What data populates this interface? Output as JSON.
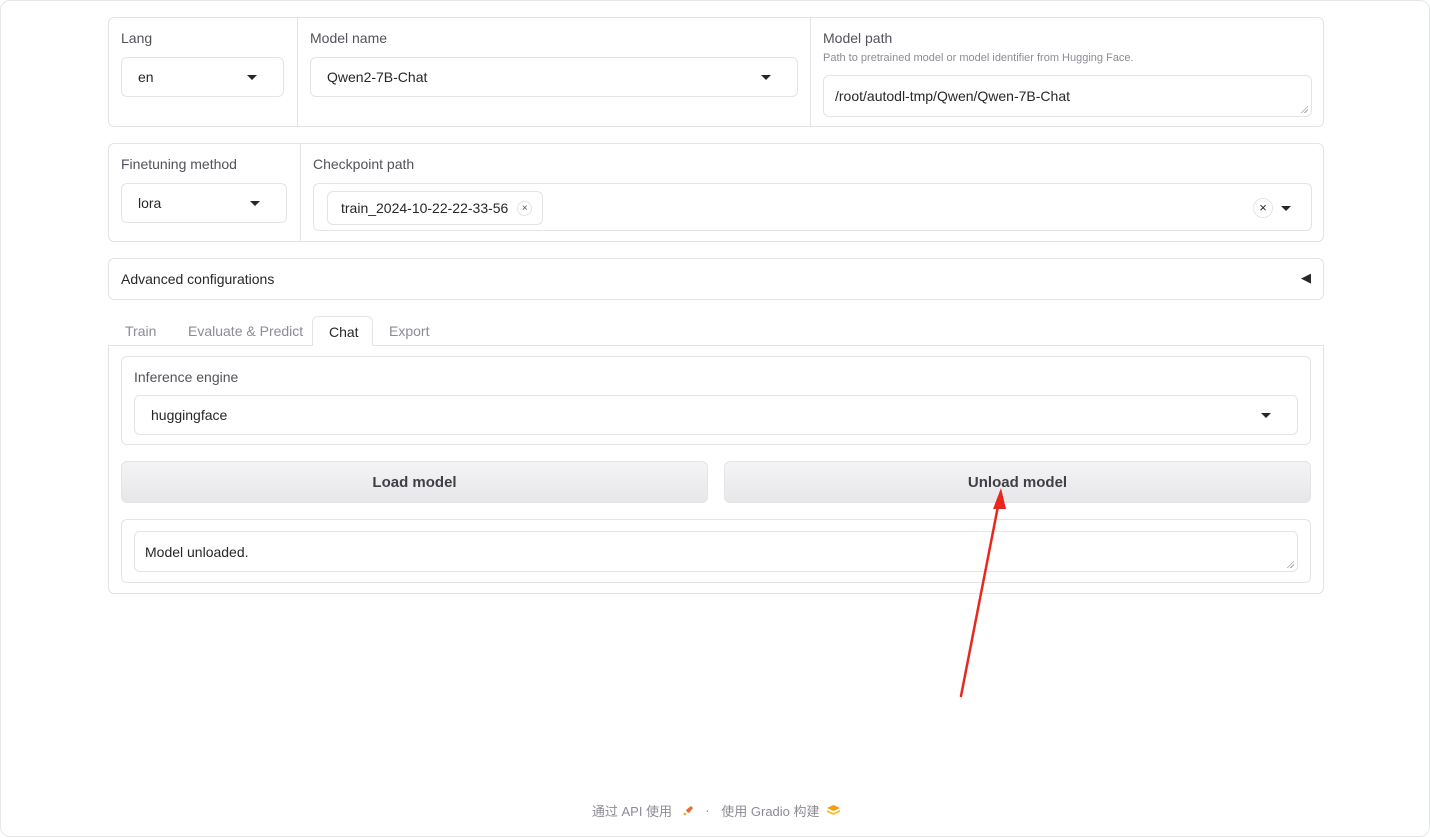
{
  "top": {
    "lang_label": "Lang",
    "lang_value": "en",
    "model_name_label": "Model name",
    "model_name_value": "Qwen2-7B-Chat",
    "model_path_label": "Model path",
    "model_path_hint": "Path to pretrained model or model identifier from Hugging Face.",
    "model_path_value": "/root/autodl-tmp/Qwen/Qwen-7B-Chat"
  },
  "second": {
    "finetune_label": "Finetuning method",
    "finetune_value": "lora",
    "checkpoint_label": "Checkpoint path",
    "checkpoint_token": "train_2024-10-22-22-33-56",
    "token_remove": "×",
    "clear_all": "×"
  },
  "advanced": {
    "label": "Advanced configurations",
    "toggle": "◀"
  },
  "tabs": [
    {
      "label": "Train"
    },
    {
      "label": "Evaluate & Predict"
    },
    {
      "label": "Chat"
    },
    {
      "label": "Export"
    }
  ],
  "chat": {
    "engine_label": "Inference engine",
    "engine_value": "huggingface",
    "load_button": "Load model",
    "unload_button": "Unload model",
    "status_text": "Model unloaded."
  },
  "footer": {
    "api_text": "通过 API 使用",
    "separator": "·",
    "built_text": "使用 Gradio 构建"
  },
  "colors": {
    "annotation_arrow": "#e8281e",
    "border": "#e4e4e7",
    "button_bg": "#ececee"
  }
}
